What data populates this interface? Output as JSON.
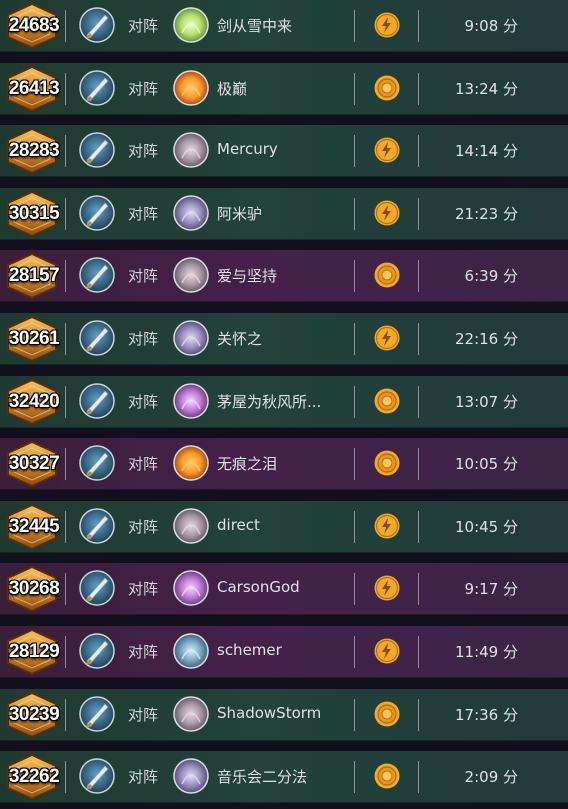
{
  "matches": [
    {
      "rank": "24683",
      "mode": "对阵",
      "hero": "green-leaf",
      "name": "剑从雪中来",
      "result": "bolt",
      "duration": "9:08 分",
      "bg": "green"
    },
    {
      "rank": "26413",
      "mode": "对阵",
      "hero": "fire-sword",
      "name": "极巅",
      "result": "coin",
      "duration": "13:24 分",
      "bg": "green"
    },
    {
      "rank": "28283",
      "mode": "对阵",
      "hero": "gray-knight",
      "name": "Mercury",
      "result": "bolt",
      "duration": "14:14 分",
      "bg": "green"
    },
    {
      "rank": "30315",
      "mode": "对阵",
      "hero": "purple-mage",
      "name": "阿米驴",
      "result": "bolt",
      "duration": "21:23 分",
      "bg": "green"
    },
    {
      "rank": "28157",
      "mode": "对阵",
      "hero": "gray-knight",
      "name": "爱与坚持",
      "result": "coin",
      "duration": "6:39 分",
      "bg": "purple"
    },
    {
      "rank": "30261",
      "mode": "对阵",
      "hero": "purple-mage",
      "name": "关怀之",
      "result": "bolt",
      "duration": "22:16 分",
      "bg": "green"
    },
    {
      "rank": "32420",
      "mode": "对阵",
      "hero": "violet-burst",
      "name": "茅屋为秋风所...",
      "result": "coin",
      "duration": "13:07 分",
      "bg": "green"
    },
    {
      "rank": "30327",
      "mode": "对阵",
      "hero": "fire-sword",
      "name": "无痕之泪",
      "result": "coin",
      "duration": "10:05 分",
      "bg": "purple"
    },
    {
      "rank": "32445",
      "mode": "对阵",
      "hero": "gray-knight",
      "name": "direct",
      "result": "bolt",
      "duration": "10:45 分",
      "bg": "green"
    },
    {
      "rank": "30268",
      "mode": "对阵",
      "hero": "violet-burst",
      "name": "CarsonGod",
      "result": "bolt",
      "duration": "9:17 分",
      "bg": "purple"
    },
    {
      "rank": "28129",
      "mode": "对阵",
      "hero": "blue-sword",
      "name": "schemer",
      "result": "bolt",
      "duration": "11:49 分",
      "bg": "purple"
    },
    {
      "rank": "30239",
      "mode": "对阵",
      "hero": "gray-knight",
      "name": "ShadowStorm",
      "result": "coin",
      "duration": "17:36 分",
      "bg": "green"
    },
    {
      "rank": "32262",
      "mode": "对阵",
      "hero": "purple-mage",
      "name": "音乐会二分法",
      "result": "coin",
      "duration": "2:09 分",
      "bg": "green"
    }
  ],
  "icons": {
    "rank_badge": "hexagon-rank-icon",
    "mode": "sword-mode-icon",
    "result_bolt": "bolt-result-icon",
    "result_coin": "coin-result-icon"
  },
  "colors": {
    "green_row": "#23423a",
    "purple_row": "#45214a",
    "badge_gold": "#e0a03c",
    "result_gold": "#f2a92a"
  }
}
